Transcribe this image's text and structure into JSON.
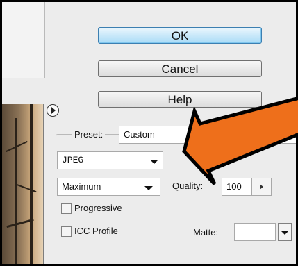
{
  "buttons": {
    "ok": "OK",
    "cancel": "Cancel",
    "help": "Help"
  },
  "preset": {
    "label": "Preset:",
    "value": "Custom"
  },
  "format": {
    "value": "JPEG"
  },
  "quality": {
    "level": "Maximum",
    "label": "Quality:",
    "value": "100"
  },
  "options": {
    "progressive": "Progressive",
    "icc_profile": "ICC Profile"
  },
  "matte": {
    "label": "Matte:"
  },
  "colors": {
    "annotation_fill": "#ee6f1b",
    "annotation_stroke": "#000000",
    "ok_accent": "#7fc6ee"
  },
  "icons": [
    "panel-menu-icon",
    "dropdown-arrow-icon",
    "stepper-arrow-icon",
    "annotation-arrow"
  ]
}
